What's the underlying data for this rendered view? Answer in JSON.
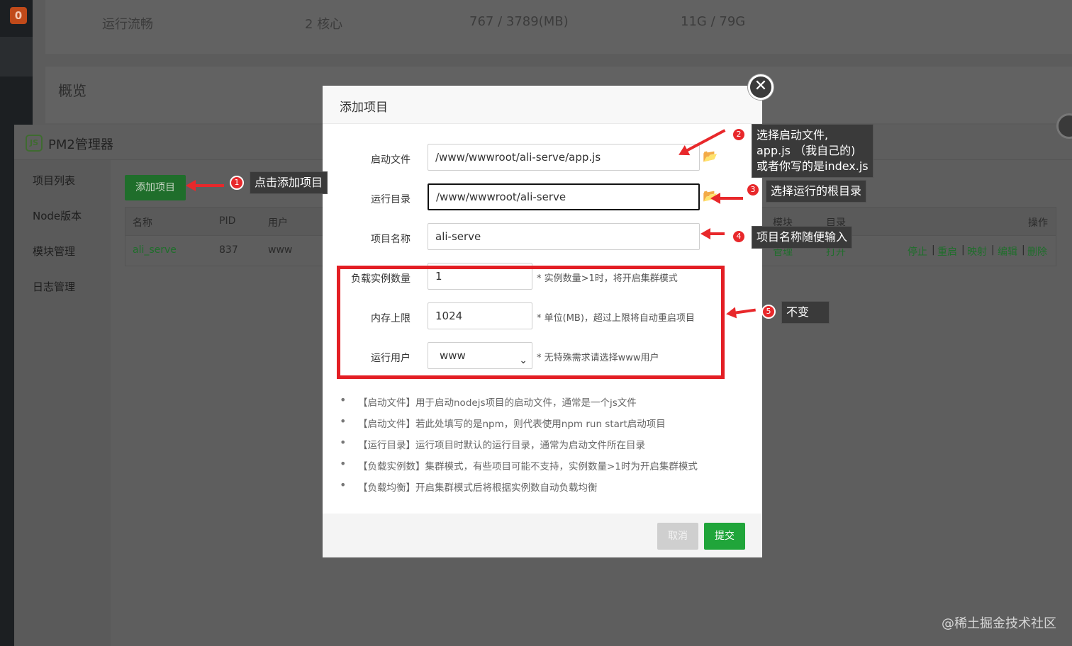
{
  "badge_count": "0",
  "stats": [
    "运行流畅",
    "2 核心",
    "767 / 3789(MB)",
    "11G / 79G"
  ],
  "overview_title": "概览",
  "pm2": {
    "logo_text": "JS",
    "title": "PM2管理器",
    "sidebar": [
      "项目列表",
      "Node版本",
      "模块管理",
      "日志管理"
    ],
    "add_button": "添加项目",
    "table_headers": [
      "名称",
      "PID",
      "用户",
      "模块",
      "目录",
      "操作"
    ],
    "row": {
      "name": "ali_serve",
      "pid": "837",
      "user": "www",
      "module": "管理",
      "dir": "打开",
      "actions": [
        "停止",
        "重启",
        "映射",
        "编辑",
        "删除"
      ]
    }
  },
  "modal": {
    "title": "添加项目",
    "close_glyph": "✕",
    "fields": {
      "start_file": {
        "label": "启动文件",
        "value": "/www/wwwroot/ali-serve/app.js"
      },
      "run_dir": {
        "label": "运行目录",
        "value": "/www/wwwroot/ali-serve"
      },
      "project_name": {
        "label": "项目名称",
        "value": "ali-serve"
      },
      "instances": {
        "label": "负载实例数量",
        "value": "1",
        "hint": "* 实例数量>1时，将开启集群模式"
      },
      "memory": {
        "label": "内存上限",
        "value": "1024",
        "hint": "* 单位(MB)，超过上限将自动重启项目"
      },
      "run_user": {
        "label": "运行用户",
        "value": "www",
        "hint": "* 无特殊需求请选择www用户"
      }
    },
    "tips": [
      "【启动文件】用于启动nodejs项目的启动文件，通常是一个js文件",
      "【启动文件】若此处填写的是npm，则代表使用npm run start启动项目",
      "【运行目录】运行项目时默认的运行目录，通常为启动文件所在目录",
      "【负载实例数】集群模式，有些项目可能不支持，实例数量>1时为开启集群模式",
      "【负载均衡】开启集群模式后将根据实例数自动负载均衡"
    ],
    "cancel": "取消",
    "submit": "提交"
  },
  "annotations": {
    "n1": "1",
    "c1": "点击添加项目",
    "n2": "2",
    "c2_l1": "选择启动文件,",
    "c2_l2": "app.js （我自己的)",
    "c2_l3": "或者你写的是index.js",
    "n3": "3",
    "c3": "选择运行的根目录",
    "n4": "4",
    "c4": "项目名称随便输入",
    "n5": "5",
    "c5": "不变"
  },
  "watermark": "@稀土掘金技术社区",
  "colors": {
    "accent_green": "#20a53a",
    "annotation_red": "#e8282b"
  }
}
